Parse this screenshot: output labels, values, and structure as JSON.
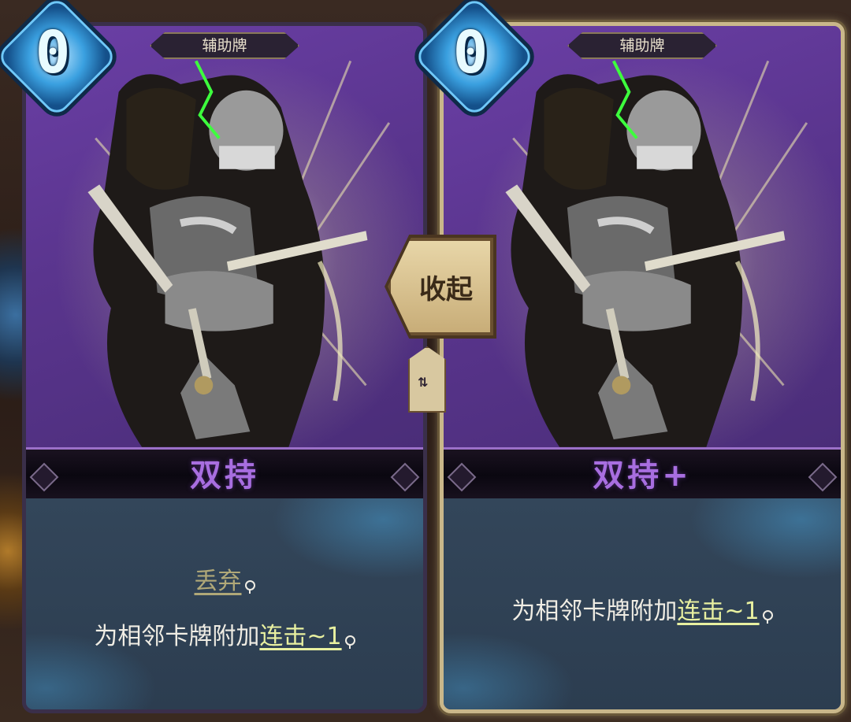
{
  "cards": [
    {
      "cost": "0",
      "type": "辅助牌",
      "name": "双持",
      "keyword_discard": "丢弃",
      "desc_prefix": "为相邻卡牌附加",
      "keyword_combo": "连击~1"
    },
    {
      "cost": "0",
      "type": "辅助牌",
      "name": "双持+",
      "desc_prefix": "为相邻卡牌附加",
      "keyword_combo": "连击~1"
    }
  ],
  "collapse_button": "收起",
  "colors": {
    "card_bg": "#5a3a8a",
    "name_text": "#a86ee0",
    "keyword_combo": "#e8f0a0",
    "keyword_discard": "#b0a878",
    "cost_gem": "#3aa0e0"
  }
}
